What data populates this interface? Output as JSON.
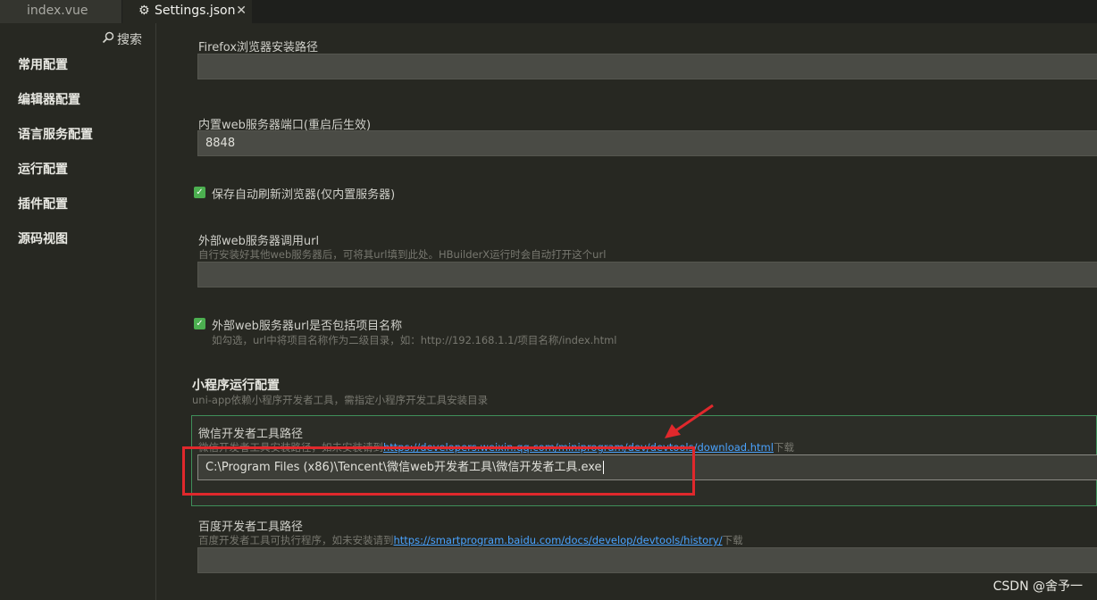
{
  "tabs": [
    {
      "label": "index.vue"
    },
    {
      "label": "Settings.json"
    }
  ],
  "sidebar": {
    "search_label": "搜索",
    "items": [
      {
        "label": "常用配置"
      },
      {
        "label": "编辑器配置"
      },
      {
        "label": "语言服务配置"
      },
      {
        "label": "运行配置"
      },
      {
        "label": "插件配置"
      },
      {
        "label": "源码视图"
      }
    ]
  },
  "settings": {
    "firefox_path_label": "Firefox浏览器安装路径",
    "firefox_path_value": "",
    "port_label": "内置web服务器端口(重启后生效)",
    "port_value": "8848",
    "auto_refresh_label": "保存自动刷新浏览器(仅内置服务器)",
    "external_url_label": "外部web服务器调用url",
    "external_url_desc": "自行安装好其他web服务器后，可将其url填到此处。HBuilderX运行时会自动打开这个url",
    "external_url_value": "",
    "include_project_label": "外部web服务器url是否包括项目名称",
    "include_project_desc": "如勾选，url中将项目名称作为二级目录，如：http://192.168.1.1/项目名称/index.html"
  },
  "miniprogram": {
    "title": "小程序运行配置",
    "desc": "uni-app依赖小程序开发者工具，需指定小程序开发工具安装目录",
    "wechat_label": "微信开发者工具路径",
    "wechat_desc_prefix": "微信开发者工具安装路径，如未安装请到",
    "wechat_link": "https://developers.weixin.qq.com/miniprogram/dev/devtools/download.html",
    "wechat_desc_suffix": "下载",
    "wechat_value": "C:\\Program Files (x86)\\Tencent\\微信web开发者工具\\微信开发者工具.exe",
    "baidu_label": "百度开发者工具路径",
    "baidu_desc_prefix": "百度开发者工具可执行程序，如未安装请到",
    "baidu_link": "https://smartprogram.baidu.com/docs/develop/devtools/history/",
    "baidu_desc_suffix": "下载",
    "baidu_value": ""
  },
  "watermark": "CSDN @舍予一",
  "colors": {
    "accent_check": "#4caf50",
    "highlight_border": "#e0282c",
    "link": "#4aa3ff"
  }
}
